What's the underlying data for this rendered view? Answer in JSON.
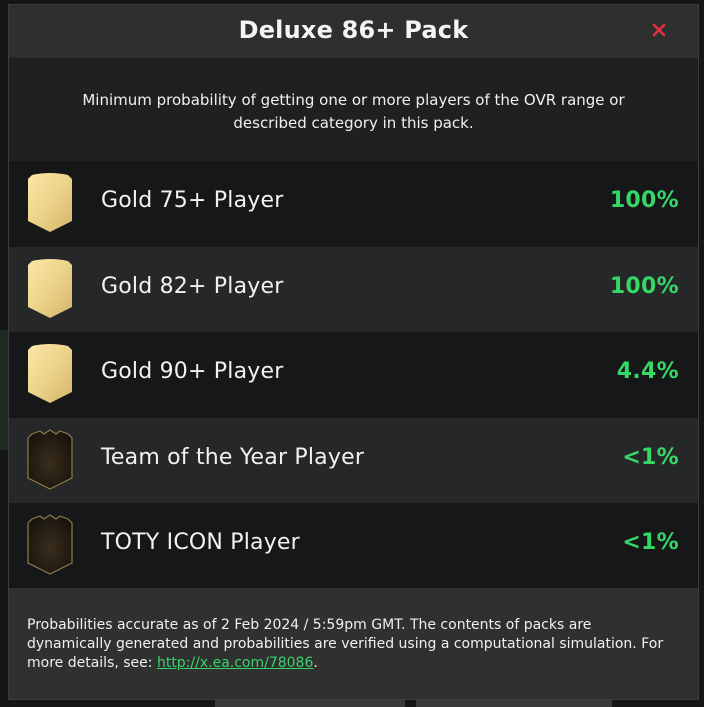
{
  "modal": {
    "title": "Deluxe 86+ Pack",
    "subtitle": "Minimum probability of getting one or more players of the OVR range or described category in this pack.",
    "close_icon": "close-x-icon",
    "accent_color": "#35d867",
    "close_color": "#e0313d"
  },
  "rows": [
    {
      "label": "Gold 75+ Player",
      "value": "100%",
      "card": "gold-card-icon"
    },
    {
      "label": "Gold 82+ Player",
      "value": "100%",
      "card": "gold-card-icon"
    },
    {
      "label": "Gold 90+ Player",
      "value": "4.4%",
      "card": "gold-card-icon"
    },
    {
      "label": "Team of the Year Player",
      "value": "<1%",
      "card": "toty-card-icon"
    },
    {
      "label": "TOTY ICON Player",
      "value": "<1%",
      "card": "toty-card-icon"
    }
  ],
  "footer": {
    "text": "Probabilities accurate as of 2 Feb 2024 / 5:59pm GMT. The contents of packs are dynamically generated and probabilities are verified using a computational simulation. For more details, see: ",
    "link_text": "http://x.ea.com/78086",
    "suffix": "."
  }
}
